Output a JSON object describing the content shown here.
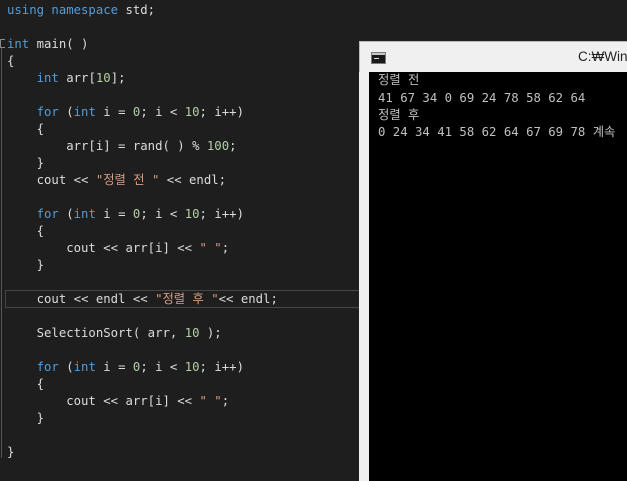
{
  "editor": {
    "lines": {
      "l01": "using namespace std;",
      "l02": "int main( )",
      "l03": "{",
      "l04": "int arr[10];",
      "l05": "for (int i = 0; i < 10; i++)",
      "l06": "{",
      "l07": "arr[i] = rand( ) % 100;",
      "l08": "}",
      "l09": "cout << \"정렬 전 \" << endl;",
      "l10": "for (int i = 0; i < 10; i++)",
      "l11": "{",
      "l12": "cout << arr[i] << \" \";",
      "l13": "}",
      "l14": "cout << endl << \"정렬 후 \"<< endl;",
      "l15": "SelectionSort( arr, 10 );",
      "l16": "for (int i = 0; i < 10; i++)",
      "l17": "{",
      "l18": "cout << arr[i] << \" \";",
      "l19": "}",
      "l20": "}"
    }
  },
  "console": {
    "title": "C:₩Win",
    "icon": "console-window-icon",
    "output": [
      "정렬 전",
      "41 67 34 0 69 24 78 58 62 64",
      "정렬 후",
      "0 24 34 41 58 62 64 67 69 78 계속"
    ]
  },
  "colors": {
    "editor_background": "#1e1e1e",
    "keyword": "#569cd6",
    "number": "#b5cea8",
    "string": "#d69d85",
    "text": "#dcdcdc",
    "console_background": "#000000",
    "console_text": "#c0c0c0"
  }
}
